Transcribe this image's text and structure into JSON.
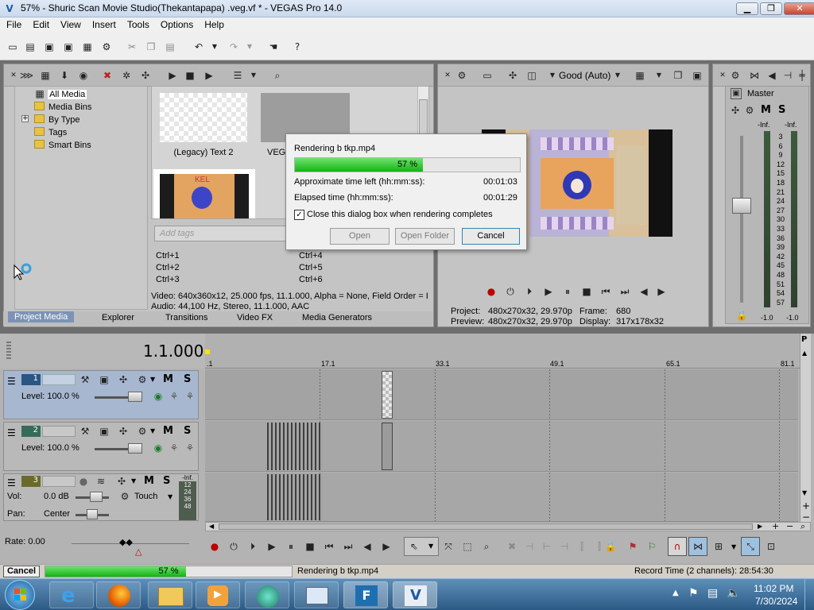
{
  "titlebar": {
    "title": "57% - Shuric Scan Movie Studio(Thekantapapa) .veg.vf * - VEGAS Pro 14.0",
    "minimize": "▁",
    "maximize": "❐",
    "close": "✕"
  },
  "menu": [
    "File",
    "Edit",
    "View",
    "Insert",
    "Tools",
    "Options",
    "Help"
  ],
  "explorer": {
    "tree": [
      "All Media",
      "Media Bins",
      "By Type",
      "Tags",
      "Smart Bins"
    ],
    "expand": "+",
    "thumbs": [
      {
        "label": "(Legacy) Text 2"
      },
      {
        "label": "VEGA"
      }
    ],
    "tags_placeholder": "Add tags",
    "shortcuts": [
      "Ctrl+1",
      "Ctrl+2",
      "Ctrl+3",
      "Ctrl+4",
      "Ctrl+5",
      "Ctrl+6"
    ],
    "video_info": "Video: 640x360x12, 25.000 fps, 11.1.000, Alpha = None, Field Order = I",
    "audio_info": "Audio: 44,100 Hz, Stereo, 11.1.000, AAC",
    "tabs": [
      "Project Media",
      "Explorer",
      "Transitions",
      "Video FX",
      "Media Generators"
    ],
    "thumb_text": "KEL"
  },
  "dialog": {
    "title": "Rendering b tkp.mp4",
    "progress_percent": 57,
    "progress_text": "57 %",
    "time_left_label": "Approximate time left (hh:mm:ss):",
    "time_left": "00:01:03",
    "elapsed_label": "Elapsed time (hh:mm:ss):",
    "elapsed": "00:01:29",
    "close_when_done_label": "Close this dialog box when rendering completes",
    "close_when_done": true,
    "buttons": [
      "Open",
      "Open Folder",
      "Cancel"
    ]
  },
  "preview": {
    "quality": "Good (Auto)",
    "project_label": "Project:",
    "project_value": "480x270x32, 29.970p",
    "preview_label": "Preview:",
    "preview_value": "480x270x32, 29.970p",
    "frame_label": "Frame:",
    "frame_value": "680",
    "display_label": "Display:",
    "display_value": "317x178x32"
  },
  "master": {
    "title": "Master",
    "mute": "M",
    "solo": "S",
    "inf_left": "-Inf.",
    "inf_right": "-Inf.",
    "scale": [
      "3",
      "6",
      "9",
      "12",
      "15",
      "18",
      "21",
      "24",
      "27",
      "30",
      "33",
      "36",
      "39",
      "42",
      "45",
      "48",
      "51",
      "54",
      "57"
    ],
    "bottom_left": "-1.0",
    "bottom_right": "-1.0"
  },
  "timeline": {
    "time": "1.1.000",
    "markers": [
      ".1",
      "17.1",
      "33.1",
      "49.1",
      "65.1",
      "81.1"
    ],
    "tracks": [
      {
        "num": "1",
        "level": "Level: 100.0 %",
        "mute": "M",
        "solo": "S"
      },
      {
        "num": "2",
        "level": "Level: 100.0 %",
        "mute": "M",
        "solo": "S"
      },
      {
        "num": "3",
        "vol_label": "Vol:",
        "vol": "0.0 dB",
        "pan_label": "Pan:",
        "pan": "Center",
        "touch": "Touch",
        "mute": "M",
        "solo": "S",
        "meter": [
          "-Inf.",
          "12",
          "24",
          "36",
          "48"
        ]
      }
    ],
    "rate": "Rate: 0.00"
  },
  "statusbar": {
    "cancel": "Cancel",
    "progress_percent": 57,
    "progress_text": "57 %",
    "rendering": "Rendering b tkp.mp4",
    "record_time": "Record Time (2 channels): 28:54:30"
  },
  "taskbar": {
    "time": "11:02 PM",
    "date": "7/30/2024"
  }
}
